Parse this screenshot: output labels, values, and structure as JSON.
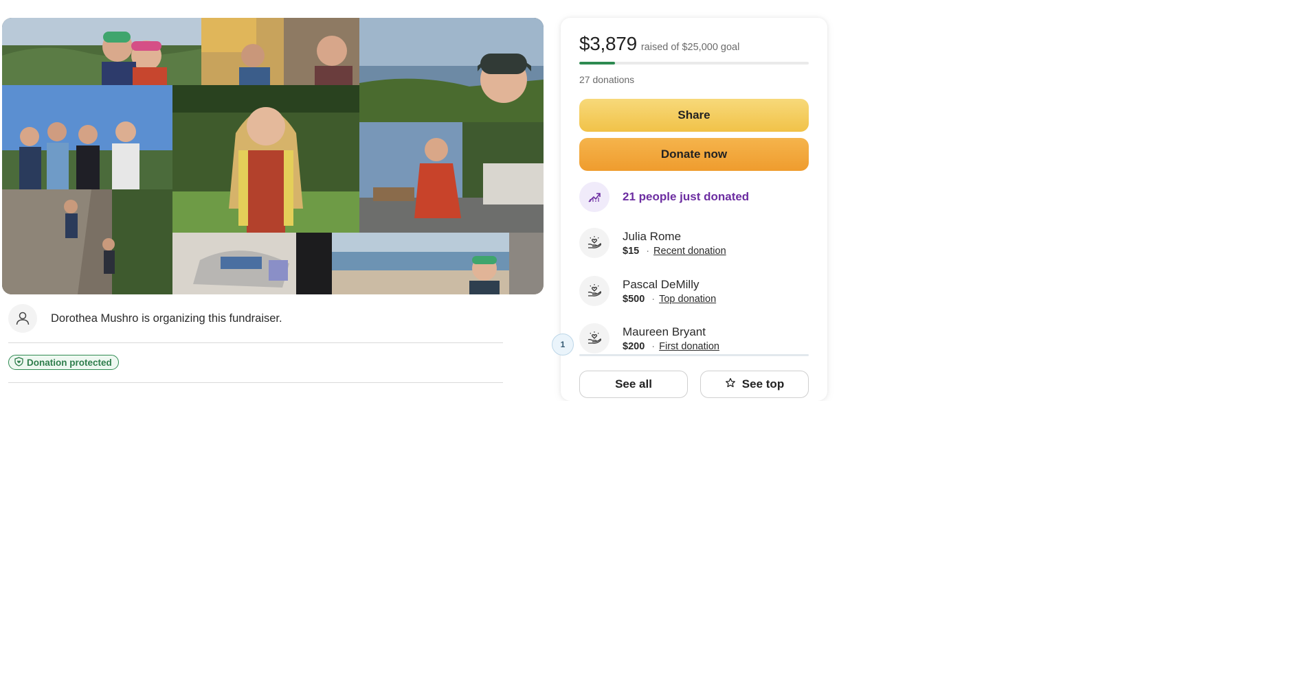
{
  "organizer": {
    "text": "Dorothea Mushro is organizing this fundraiser."
  },
  "badge": {
    "label": "Donation protected"
  },
  "fundraiser": {
    "raised_amount": "$3,879",
    "raised_goal_text": "raised of $25,000 goal",
    "progress_fraction": 0.155,
    "donation_count": "27 donations",
    "share_label": "Share",
    "donate_label": "Donate now",
    "trend_text": "21 people just donated",
    "donations": [
      {
        "name": "Julia Rome",
        "amount": "$15",
        "tag": "Recent donation"
      },
      {
        "name": "Pascal DeMilly",
        "amount": "$500",
        "tag": "Top donation"
      },
      {
        "name": "Maureen Bryant",
        "amount": "$200",
        "tag": "First donation"
      }
    ],
    "step_marker": "1",
    "see_all_label": "See all",
    "see_top_label": "See top"
  },
  "colors": {
    "progress": "#2e8a51",
    "share_button": "#f1c248",
    "donate_button": "#ef9c2e",
    "trend_text": "#6c2da1",
    "badge": "#2e8a51"
  },
  "icons": {
    "organizer": "user-outline-icon",
    "badge": "shield-heart-icon",
    "trend": "trending-up-icon",
    "donation": "hand-heart-icon",
    "see_top": "star-outline-icon"
  }
}
